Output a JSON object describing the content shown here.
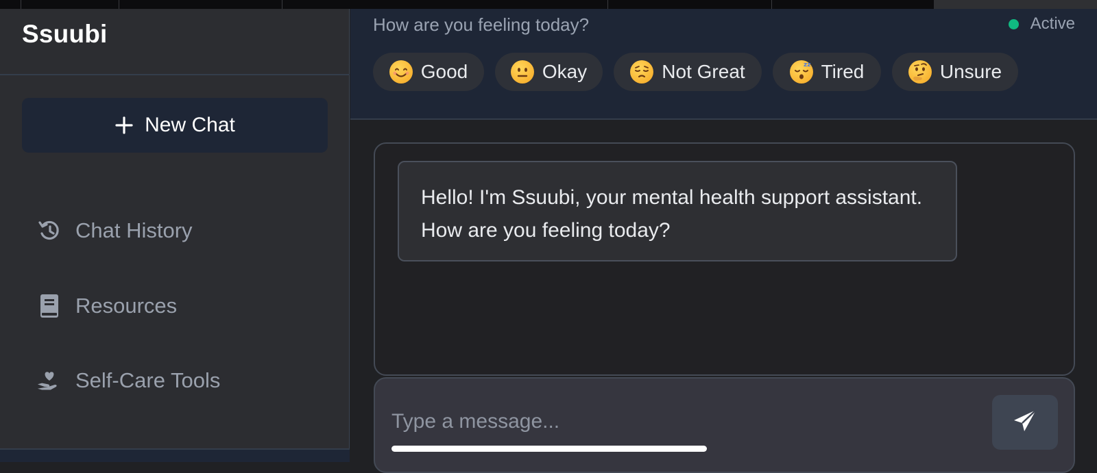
{
  "app": {
    "name": "Ssuubi"
  },
  "sidebar": {
    "new_chat_label": "New Chat",
    "items": [
      {
        "label": "Chat History",
        "icon": "history-icon"
      },
      {
        "label": "Resources",
        "icon": "book-icon"
      },
      {
        "label": "Self-Care Tools",
        "icon": "hand-heart-icon"
      }
    ]
  },
  "header": {
    "question": "How are you feeling today?",
    "status": "Active",
    "status_color": "#10b981",
    "moods": [
      {
        "label": "Good",
        "icon": "smiling-face-emoji"
      },
      {
        "label": "Okay",
        "icon": "neutral-face-emoji"
      },
      {
        "label": "Not Great",
        "icon": "pensive-face-emoji"
      },
      {
        "label": "Tired",
        "icon": "sleeping-face-emoji"
      },
      {
        "label": "Unsure",
        "icon": "thinking-face-emoji"
      }
    ]
  },
  "chat": {
    "messages": [
      {
        "sender": "assistant",
        "text": "Hello! I'm Ssuubi, your mental health support assistant. How are you feeling today?"
      }
    ]
  },
  "composer": {
    "placeholder": "Type a message...",
    "value": ""
  },
  "colors": {
    "sidebar_bg": "#2c2d31",
    "header_bg": "#1e2636",
    "accent_active": "#10b981"
  }
}
